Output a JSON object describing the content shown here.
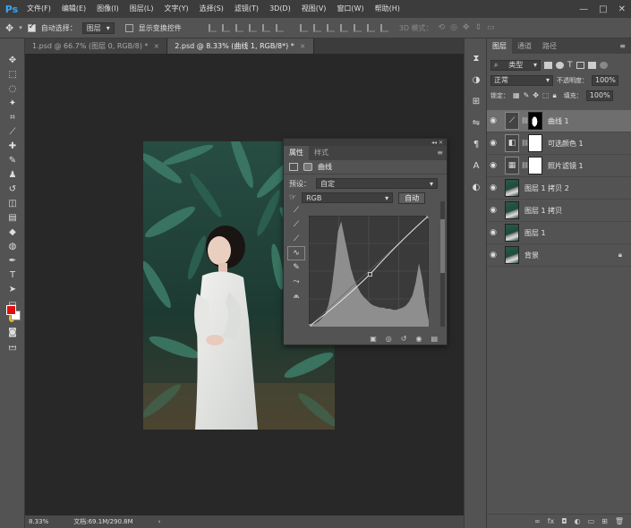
{
  "menubar": {
    "logo": "Ps",
    "items": [
      "文件(F)",
      "编辑(E)",
      "图像(I)",
      "图层(L)",
      "文字(Y)",
      "选择(S)",
      "滤镜(T)",
      "3D(D)",
      "视图(V)",
      "窗口(W)",
      "帮助(H)"
    ],
    "win_controls": [
      "—",
      "□",
      "✕"
    ]
  },
  "options": {
    "auto_select_label": "自动选择：",
    "auto_select_value": "图层",
    "show_transform_label": "显示变换控件",
    "mode_3d": "3D 模式："
  },
  "tabs": [
    {
      "label": "1.psd @ 66.7% (图层 0, RGB/8) *",
      "close": "×"
    },
    {
      "label": "2.psd @ 8.33% (曲线 1, RGB/8*) *",
      "close": "×"
    }
  ],
  "status": {
    "zoom": "8.33%",
    "doc": "文档:69.1M/290.8M",
    "arrow": "›"
  },
  "properties": {
    "tab_properties": "属性",
    "tab_styles": "样式",
    "header_title": "曲线",
    "preset_label": "预设：",
    "preset_value": "自定",
    "channel_value": "RGB",
    "auto_button": "自动",
    "menu_icon": "≡",
    "top_icons": "◂◂ ✕"
  },
  "layers_panel": {
    "tab_layers": "图层",
    "tab_channels": "通道",
    "tab_paths": "路径",
    "menu_icon": "≡",
    "filter_kind": "类型",
    "blend_mode": "正常",
    "opacity_label": "不透明度：",
    "opacity_value": "100%",
    "lock_label": "锁定：",
    "fill_label": "填充：",
    "fill_value": "100%",
    "layers": [
      {
        "name": "曲线 1",
        "type": "adjustment",
        "icon": "curves-icon",
        "glyph": "⟋",
        "selected": true
      },
      {
        "name": "可选颜色 1",
        "type": "adjustment",
        "icon": "selective-color-icon",
        "glyph": "◧",
        "selected": false
      },
      {
        "name": "照片滤镜 1",
        "type": "adjustment",
        "icon": "photo-filter-icon",
        "glyph": "▦",
        "selected": false
      },
      {
        "name": "图层 1 拷贝 2",
        "type": "image",
        "selected": false
      },
      {
        "name": "图层 1 拷贝",
        "type": "image",
        "selected": false
      },
      {
        "name": "图层 1",
        "type": "image",
        "selected": false
      },
      {
        "name": "背景",
        "type": "image",
        "locked": true,
        "selected": false
      }
    ],
    "bottom_icons": [
      "∞",
      "fx",
      "◘",
      "◐",
      "▭",
      "⊞",
      "🗑"
    ]
  },
  "colors": {
    "foreground": "#e01010",
    "background": "#ffffff",
    "accent": "#31a8ff"
  },
  "chart_data": {
    "type": "area",
    "title": "",
    "curve_points": [
      [
        0,
        0
      ],
      [
        130,
        120
      ],
      [
        255,
        255
      ]
    ],
    "histogram_note_values": [
      0.02,
      0.02,
      0.03,
      0.05,
      0.08,
      0.12,
      0.2,
      0.35,
      0.6,
      0.9,
      1.0,
      0.85,
      0.7,
      0.55,
      0.45,
      0.38,
      0.32,
      0.28,
      0.25,
      0.22,
      0.2,
      0.19,
      0.18,
      0.18,
      0.17,
      0.17,
      0.16,
      0.16,
      0.17,
      0.18,
      0.2,
      0.24,
      0.3,
      0.42,
      0.6,
      0.45,
      0.22,
      0.06
    ],
    "xlim": [
      0,
      255
    ],
    "ylim": [
      0,
      255
    ]
  }
}
